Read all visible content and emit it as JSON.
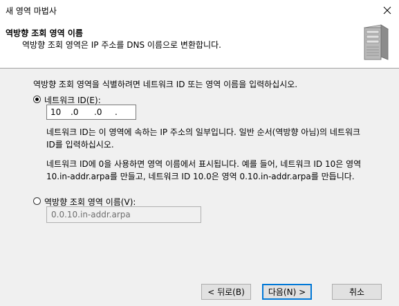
{
  "window": {
    "title": "새 영역 마법사"
  },
  "header": {
    "title": "역방향 조회 영역 이름",
    "subtitle": "역방향 조회 영역은 IP 주소를 DNS 이름으로 변환합니다."
  },
  "body": {
    "intro": "역방향 조회 영역을 식별하려면 네트워크 ID 또는 영역 이름을 입력하십시오.",
    "network_id": {
      "label": "네트워크 ID(E):",
      "selected": true,
      "octets": [
        "10",
        ".0",
        ".0",
        "."
      ]
    },
    "desc1_line1": "네트워크 ID는 이 영역에 속하는 IP 주소의 일부입니다. 일반 순서(역방향 아님)의 네트워크",
    "desc1_line2": "ID를 입력하십시오.",
    "desc2_line1": "네트워크 ID에 0을 사용하면 영역 이름에서 표시됩니다. 예를 들어, 네트워크 ID 10은 영역",
    "desc2_line2": "10.in-addr.arpa를 만들고, 네트워크 ID 10.0은 영역 0.10.in-addr.arpa를 만듭니다.",
    "zone_name": {
      "label": "역방향 조회 영역 이름(V):",
      "selected": false,
      "value": "0.0.10.in-addr.arpa"
    }
  },
  "buttons": {
    "back": "< 뒤로(B)",
    "next": "다음(N) >",
    "cancel": "취소"
  },
  "icons": {
    "close": "close-icon",
    "server": "server-icon"
  }
}
